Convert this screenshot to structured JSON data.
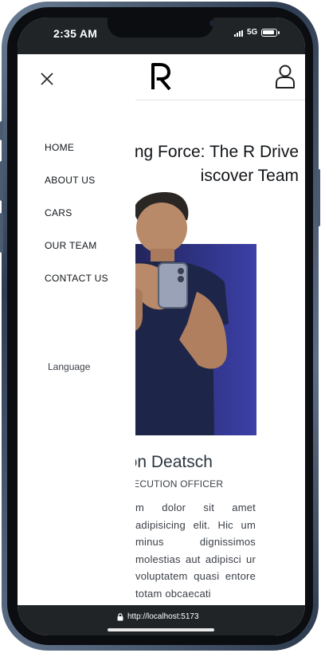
{
  "status_bar": {
    "time": "2:35 AM",
    "network": "5G"
  },
  "header": {
    "logo_letter": "R"
  },
  "page": {
    "title": "ng Force: The R Drive\niscover Team",
    "member_name": "eron Deatsch",
    "member_role": "XECUTION OFFICER",
    "member_bio": "m dolor sit amet adipisicing elit. Hic um minus dignissimos molestias aut adipisci ur voluptatem quasi entore totam obcaecati"
  },
  "drawer": {
    "nav_items": [
      {
        "label": "HOME"
      },
      {
        "label": "ABOUT US"
      },
      {
        "label": "CARS"
      },
      {
        "label": "OUR TEAM"
      },
      {
        "label": "CONTACT US"
      }
    ],
    "language_label": "Language"
  },
  "browser": {
    "url": "http://localhost:5173"
  },
  "colors": {
    "status_bar_bg": "#202427",
    "drawer_bg": "#ffffff",
    "portrait_bg_dark": "#1c1f4a",
    "portrait_bg_light": "#3c40a8",
    "text_primary": "#111418"
  }
}
